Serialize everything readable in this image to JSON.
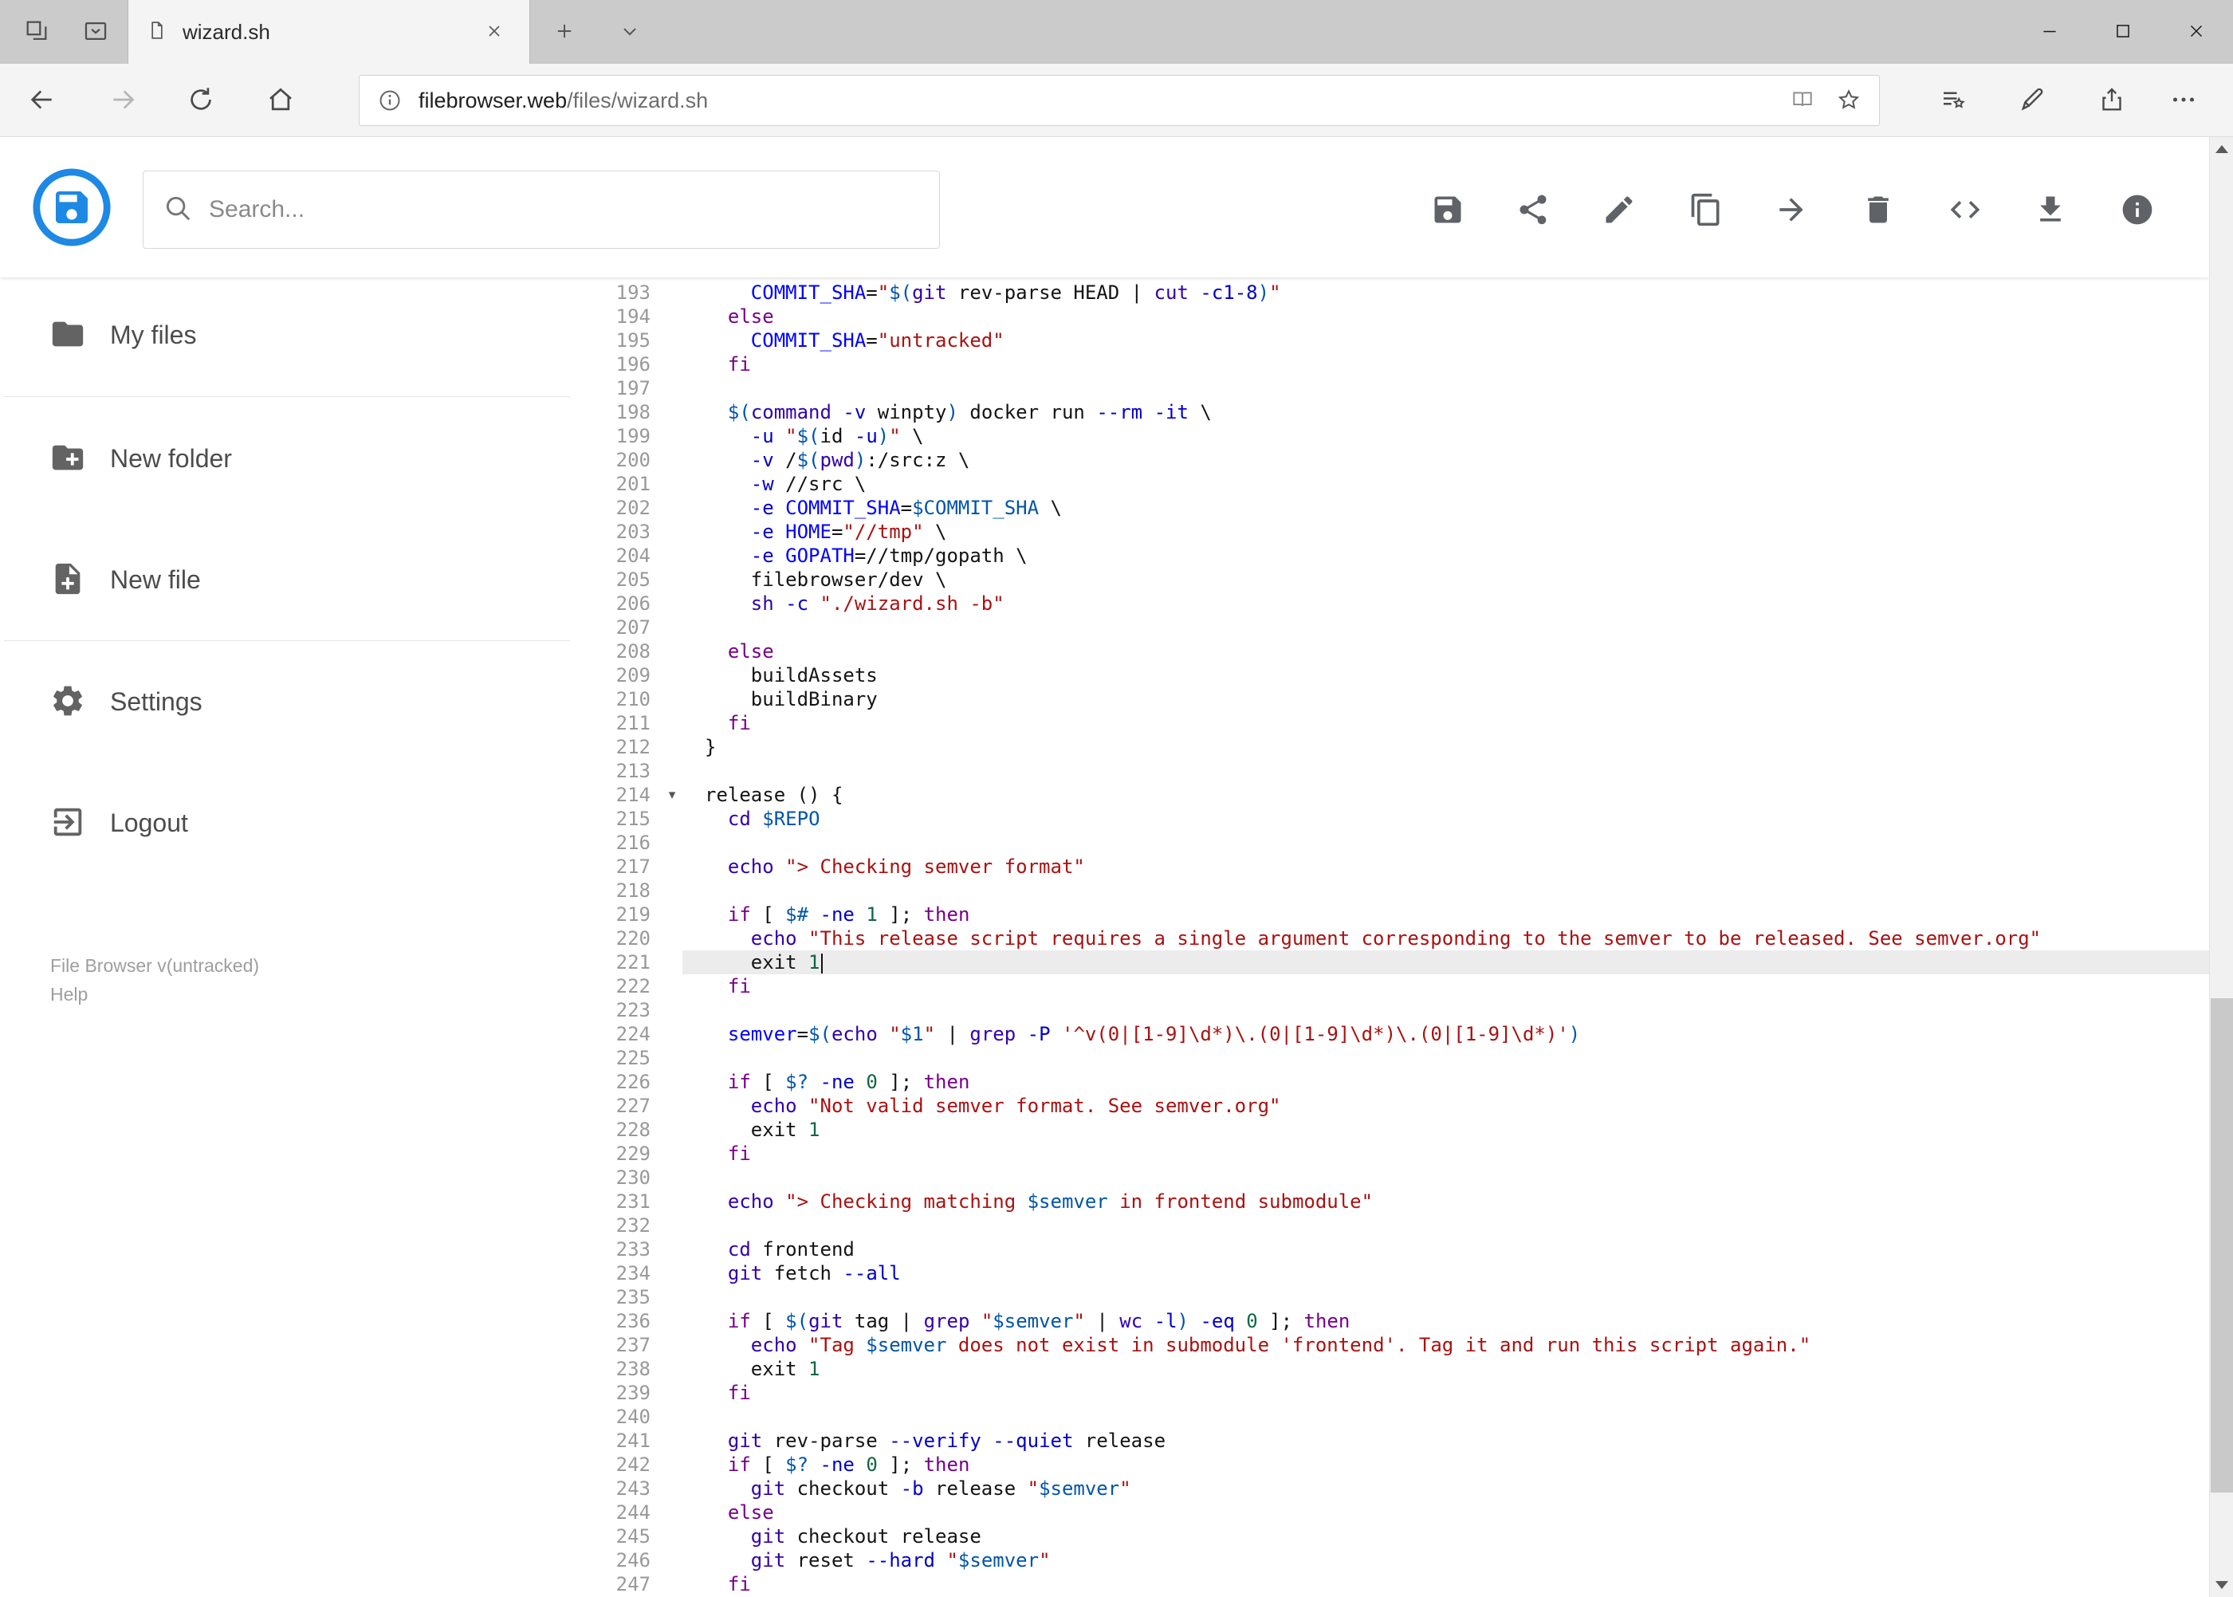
{
  "browser": {
    "tab_title": "wizard.sh",
    "url_domain": "filebrowser.web",
    "url_path": "/files/wizard.sh"
  },
  "header": {
    "search_placeholder": "Search...",
    "actions": [
      "save",
      "share",
      "edit",
      "copy",
      "move",
      "delete",
      "raw-code",
      "download",
      "info"
    ],
    "accent_color": "#1e88e5"
  },
  "sidebar": {
    "items": [
      {
        "label": "My files",
        "icon": "folder"
      },
      {
        "label": "New folder",
        "icon": "folder-plus"
      },
      {
        "label": "New file",
        "icon": "file-plus"
      },
      {
        "label": "Settings",
        "icon": "gear"
      },
      {
        "label": "Logout",
        "icon": "logout"
      }
    ],
    "footer_version": "File Browser v(untracked)",
    "footer_help": "Help"
  },
  "editor": {
    "active_line": 221,
    "cursor_line": 221,
    "token_colors": {
      "keyword": "#770088",
      "builtin": "#3300aa",
      "string": "#aa1111",
      "variable": "#0055aa",
      "definition": "#0000ff",
      "attribute": "#0000cc",
      "number": "#116644",
      "active_line_bg": "#ececec"
    },
    "lines": [
      {
        "n": 193,
        "seg": [
          [
            "p",
            "    "
          ],
          [
            "d",
            "COMMIT_SHA"
          ],
          [
            "p",
            "="
          ],
          [
            "s",
            "\""
          ],
          [
            "v",
            "$("
          ],
          [
            "b",
            "git"
          ],
          [
            "p",
            " rev-parse HEAD | "
          ],
          [
            "b",
            "cut"
          ],
          [
            "p",
            " "
          ],
          [
            "a",
            "-c1-8"
          ],
          [
            "v",
            ")"
          ],
          [
            "s",
            "\""
          ]
        ]
      },
      {
        "n": 194,
        "seg": [
          [
            "p",
            "  "
          ],
          [
            "k",
            "else"
          ]
        ]
      },
      {
        "n": 195,
        "seg": [
          [
            "p",
            "    "
          ],
          [
            "d",
            "COMMIT_SHA"
          ],
          [
            "p",
            "="
          ],
          [
            "s",
            "\"untracked\""
          ]
        ]
      },
      {
        "n": 196,
        "seg": [
          [
            "p",
            "  "
          ],
          [
            "k",
            "fi"
          ]
        ]
      },
      {
        "n": 197,
        "seg": []
      },
      {
        "n": 198,
        "seg": [
          [
            "p",
            "  "
          ],
          [
            "v",
            "$("
          ],
          [
            "b",
            "command"
          ],
          [
            "p",
            " "
          ],
          [
            "a",
            "-v"
          ],
          [
            "p",
            " winpty"
          ],
          [
            "v",
            ")"
          ],
          [
            "p",
            " docker run "
          ],
          [
            "a",
            "--rm"
          ],
          [
            "p",
            " "
          ],
          [
            "a",
            "-it"
          ],
          [
            "p",
            " \\"
          ]
        ]
      },
      {
        "n": 199,
        "seg": [
          [
            "p",
            "    "
          ],
          [
            "a",
            "-u"
          ],
          [
            "p",
            " "
          ],
          [
            "s",
            "\""
          ],
          [
            "v",
            "$("
          ],
          [
            "p",
            "id "
          ],
          [
            "a",
            "-u"
          ],
          [
            "v",
            ")"
          ],
          [
            "s",
            "\""
          ],
          [
            "p",
            " \\"
          ]
        ]
      },
      {
        "n": 200,
        "seg": [
          [
            "p",
            "    "
          ],
          [
            "a",
            "-v"
          ],
          [
            "p",
            " /"
          ],
          [
            "v",
            "$("
          ],
          [
            "b",
            "pwd"
          ],
          [
            "v",
            ")"
          ],
          [
            "p",
            ":/src:z \\"
          ]
        ]
      },
      {
        "n": 201,
        "seg": [
          [
            "p",
            "    "
          ],
          [
            "a",
            "-w"
          ],
          [
            "p",
            " //src \\"
          ]
        ]
      },
      {
        "n": 202,
        "seg": [
          [
            "p",
            "    "
          ],
          [
            "a",
            "-e"
          ],
          [
            "p",
            " "
          ],
          [
            "d",
            "COMMIT_SHA"
          ],
          [
            "p",
            "="
          ],
          [
            "v",
            "$COMMIT_SHA"
          ],
          [
            "p",
            " \\"
          ]
        ]
      },
      {
        "n": 203,
        "seg": [
          [
            "p",
            "    "
          ],
          [
            "a",
            "-e"
          ],
          [
            "p",
            " "
          ],
          [
            "d",
            "HOME"
          ],
          [
            "p",
            "="
          ],
          [
            "s",
            "\"//tmp\""
          ],
          [
            "p",
            " \\"
          ]
        ]
      },
      {
        "n": 204,
        "seg": [
          [
            "p",
            "    "
          ],
          [
            "a",
            "-e"
          ],
          [
            "p",
            " "
          ],
          [
            "d",
            "GOPATH"
          ],
          [
            "p",
            "=//tmp/gopath \\"
          ]
        ]
      },
      {
        "n": 205,
        "seg": [
          [
            "p",
            "    filebrowser/dev \\"
          ]
        ]
      },
      {
        "n": 206,
        "seg": [
          [
            "p",
            "    "
          ],
          [
            "b",
            "sh"
          ],
          [
            "p",
            " "
          ],
          [
            "a",
            "-c"
          ],
          [
            "p",
            " "
          ],
          [
            "s",
            "\"./wizard.sh -b\""
          ]
        ]
      },
      {
        "n": 207,
        "seg": []
      },
      {
        "n": 208,
        "seg": [
          [
            "p",
            "  "
          ],
          [
            "k",
            "else"
          ]
        ]
      },
      {
        "n": 209,
        "seg": [
          [
            "p",
            "    buildAssets"
          ]
        ]
      },
      {
        "n": 210,
        "seg": [
          [
            "p",
            "    buildBinary"
          ]
        ]
      },
      {
        "n": 211,
        "seg": [
          [
            "p",
            "  "
          ],
          [
            "k",
            "fi"
          ]
        ]
      },
      {
        "n": 212,
        "seg": [
          [
            "p",
            "}"
          ]
        ]
      },
      {
        "n": 213,
        "seg": []
      },
      {
        "n": 214,
        "fold": true,
        "seg": [
          [
            "p",
            "release () {"
          ]
        ]
      },
      {
        "n": 215,
        "seg": [
          [
            "p",
            "  "
          ],
          [
            "b",
            "cd"
          ],
          [
            "p",
            " "
          ],
          [
            "v",
            "$REPO"
          ]
        ]
      },
      {
        "n": 216,
        "seg": []
      },
      {
        "n": 217,
        "seg": [
          [
            "p",
            "  "
          ],
          [
            "b",
            "echo"
          ],
          [
            "p",
            " "
          ],
          [
            "s",
            "\"> Checking semver format\""
          ]
        ]
      },
      {
        "n": 218,
        "seg": []
      },
      {
        "n": 219,
        "seg": [
          [
            "p",
            "  "
          ],
          [
            "k",
            "if"
          ],
          [
            "p",
            " [ "
          ],
          [
            "v",
            "$#"
          ],
          [
            "p",
            " "
          ],
          [
            "a",
            "-ne"
          ],
          [
            "p",
            " "
          ],
          [
            "n",
            "1"
          ],
          [
            "p",
            " ]; "
          ],
          [
            "k",
            "then"
          ]
        ]
      },
      {
        "n": 220,
        "seg": [
          [
            "p",
            "    "
          ],
          [
            "b",
            "echo"
          ],
          [
            "p",
            " "
          ],
          [
            "s",
            "\"This release script requires a single argument corresponding to the semver to be released. See semver.org\""
          ]
        ]
      },
      {
        "n": 221,
        "seg": [
          [
            "p",
            "    exit "
          ],
          [
            "n",
            "1"
          ]
        ]
      },
      {
        "n": 222,
        "seg": [
          [
            "p",
            "  "
          ],
          [
            "k",
            "fi"
          ]
        ]
      },
      {
        "n": 223,
        "seg": []
      },
      {
        "n": 224,
        "seg": [
          [
            "p",
            "  "
          ],
          [
            "d",
            "semver"
          ],
          [
            "p",
            "="
          ],
          [
            "v",
            "$("
          ],
          [
            "b",
            "echo"
          ],
          [
            "p",
            " "
          ],
          [
            "s",
            "\""
          ],
          [
            "v",
            "$1"
          ],
          [
            "s",
            "\""
          ],
          [
            "p",
            " | "
          ],
          [
            "b",
            "grep"
          ],
          [
            "p",
            " "
          ],
          [
            "a",
            "-P"
          ],
          [
            "p",
            " "
          ],
          [
            "s",
            "'^v(0|[1-9]\\d*)\\.(0|[1-9]\\d*)\\.(0|[1-9]\\d*)'"
          ],
          [
            "v",
            ")"
          ]
        ]
      },
      {
        "n": 225,
        "seg": []
      },
      {
        "n": 226,
        "seg": [
          [
            "p",
            "  "
          ],
          [
            "k",
            "if"
          ],
          [
            "p",
            " [ "
          ],
          [
            "v",
            "$?"
          ],
          [
            "p",
            " "
          ],
          [
            "a",
            "-ne"
          ],
          [
            "p",
            " "
          ],
          [
            "n",
            "0"
          ],
          [
            "p",
            " ]; "
          ],
          [
            "k",
            "then"
          ]
        ]
      },
      {
        "n": 227,
        "seg": [
          [
            "p",
            "    "
          ],
          [
            "b",
            "echo"
          ],
          [
            "p",
            " "
          ],
          [
            "s",
            "\"Not valid semver format. See semver.org\""
          ]
        ]
      },
      {
        "n": 228,
        "seg": [
          [
            "p",
            "    exit "
          ],
          [
            "n",
            "1"
          ]
        ]
      },
      {
        "n": 229,
        "seg": [
          [
            "p",
            "  "
          ],
          [
            "k",
            "fi"
          ]
        ]
      },
      {
        "n": 230,
        "seg": []
      },
      {
        "n": 231,
        "seg": [
          [
            "p",
            "  "
          ],
          [
            "b",
            "echo"
          ],
          [
            "p",
            " "
          ],
          [
            "s",
            "\"> Checking matching "
          ],
          [
            "v",
            "$semver"
          ],
          [
            "s",
            " in frontend submodule\""
          ]
        ]
      },
      {
        "n": 232,
        "seg": []
      },
      {
        "n": 233,
        "seg": [
          [
            "p",
            "  "
          ],
          [
            "b",
            "cd"
          ],
          [
            "p",
            " frontend"
          ]
        ]
      },
      {
        "n": 234,
        "seg": [
          [
            "p",
            "  "
          ],
          [
            "b",
            "git"
          ],
          [
            "p",
            " fetch "
          ],
          [
            "a",
            "--all"
          ]
        ]
      },
      {
        "n": 235,
        "seg": []
      },
      {
        "n": 236,
        "seg": [
          [
            "p",
            "  "
          ],
          [
            "k",
            "if"
          ],
          [
            "p",
            " [ "
          ],
          [
            "v",
            "$("
          ],
          [
            "b",
            "git"
          ],
          [
            "p",
            " tag | "
          ],
          [
            "b",
            "grep"
          ],
          [
            "p",
            " "
          ],
          [
            "s",
            "\""
          ],
          [
            "v",
            "$semver"
          ],
          [
            "s",
            "\""
          ],
          [
            "p",
            " | "
          ],
          [
            "b",
            "wc"
          ],
          [
            "p",
            " "
          ],
          [
            "a",
            "-l"
          ],
          [
            "v",
            ")"
          ],
          [
            "p",
            " "
          ],
          [
            "a",
            "-eq"
          ],
          [
            "p",
            " "
          ],
          [
            "n",
            "0"
          ],
          [
            "p",
            " ]; "
          ],
          [
            "k",
            "then"
          ]
        ]
      },
      {
        "n": 237,
        "seg": [
          [
            "p",
            "    "
          ],
          [
            "b",
            "echo"
          ],
          [
            "p",
            " "
          ],
          [
            "s",
            "\"Tag "
          ],
          [
            "v",
            "$semver"
          ],
          [
            "s",
            " does not exist in submodule 'frontend'. Tag it and run this script again.\""
          ]
        ]
      },
      {
        "n": 238,
        "seg": [
          [
            "p",
            "    exit "
          ],
          [
            "n",
            "1"
          ]
        ]
      },
      {
        "n": 239,
        "seg": [
          [
            "p",
            "  "
          ],
          [
            "k",
            "fi"
          ]
        ]
      },
      {
        "n": 240,
        "seg": []
      },
      {
        "n": 241,
        "seg": [
          [
            "p",
            "  "
          ],
          [
            "b",
            "git"
          ],
          [
            "p",
            " rev-parse "
          ],
          [
            "a",
            "--verify"
          ],
          [
            "p",
            " "
          ],
          [
            "a",
            "--quiet"
          ],
          [
            "p",
            " release"
          ]
        ]
      },
      {
        "n": 242,
        "seg": [
          [
            "p",
            "  "
          ],
          [
            "k",
            "if"
          ],
          [
            "p",
            " [ "
          ],
          [
            "v",
            "$?"
          ],
          [
            "p",
            " "
          ],
          [
            "a",
            "-ne"
          ],
          [
            "p",
            " "
          ],
          [
            "n",
            "0"
          ],
          [
            "p",
            " ]; "
          ],
          [
            "k",
            "then"
          ]
        ]
      },
      {
        "n": 243,
        "seg": [
          [
            "p",
            "    "
          ],
          [
            "b",
            "git"
          ],
          [
            "p",
            " checkout "
          ],
          [
            "a",
            "-b"
          ],
          [
            "p",
            " release "
          ],
          [
            "s",
            "\""
          ],
          [
            "v",
            "$semver"
          ],
          [
            "s",
            "\""
          ]
        ]
      },
      {
        "n": 244,
        "seg": [
          [
            "p",
            "  "
          ],
          [
            "k",
            "else"
          ]
        ]
      },
      {
        "n": 245,
        "seg": [
          [
            "p",
            "    "
          ],
          [
            "b",
            "git"
          ],
          [
            "p",
            " checkout release"
          ]
        ]
      },
      {
        "n": 246,
        "seg": [
          [
            "p",
            "    "
          ],
          [
            "b",
            "git"
          ],
          [
            "p",
            " reset "
          ],
          [
            "a",
            "--hard"
          ],
          [
            "p",
            " "
          ],
          [
            "s",
            "\""
          ],
          [
            "v",
            "$semver"
          ],
          [
            "s",
            "\""
          ]
        ]
      },
      {
        "n": 247,
        "seg": [
          [
            "p",
            "  "
          ],
          [
            "k",
            "fi"
          ]
        ]
      }
    ]
  }
}
